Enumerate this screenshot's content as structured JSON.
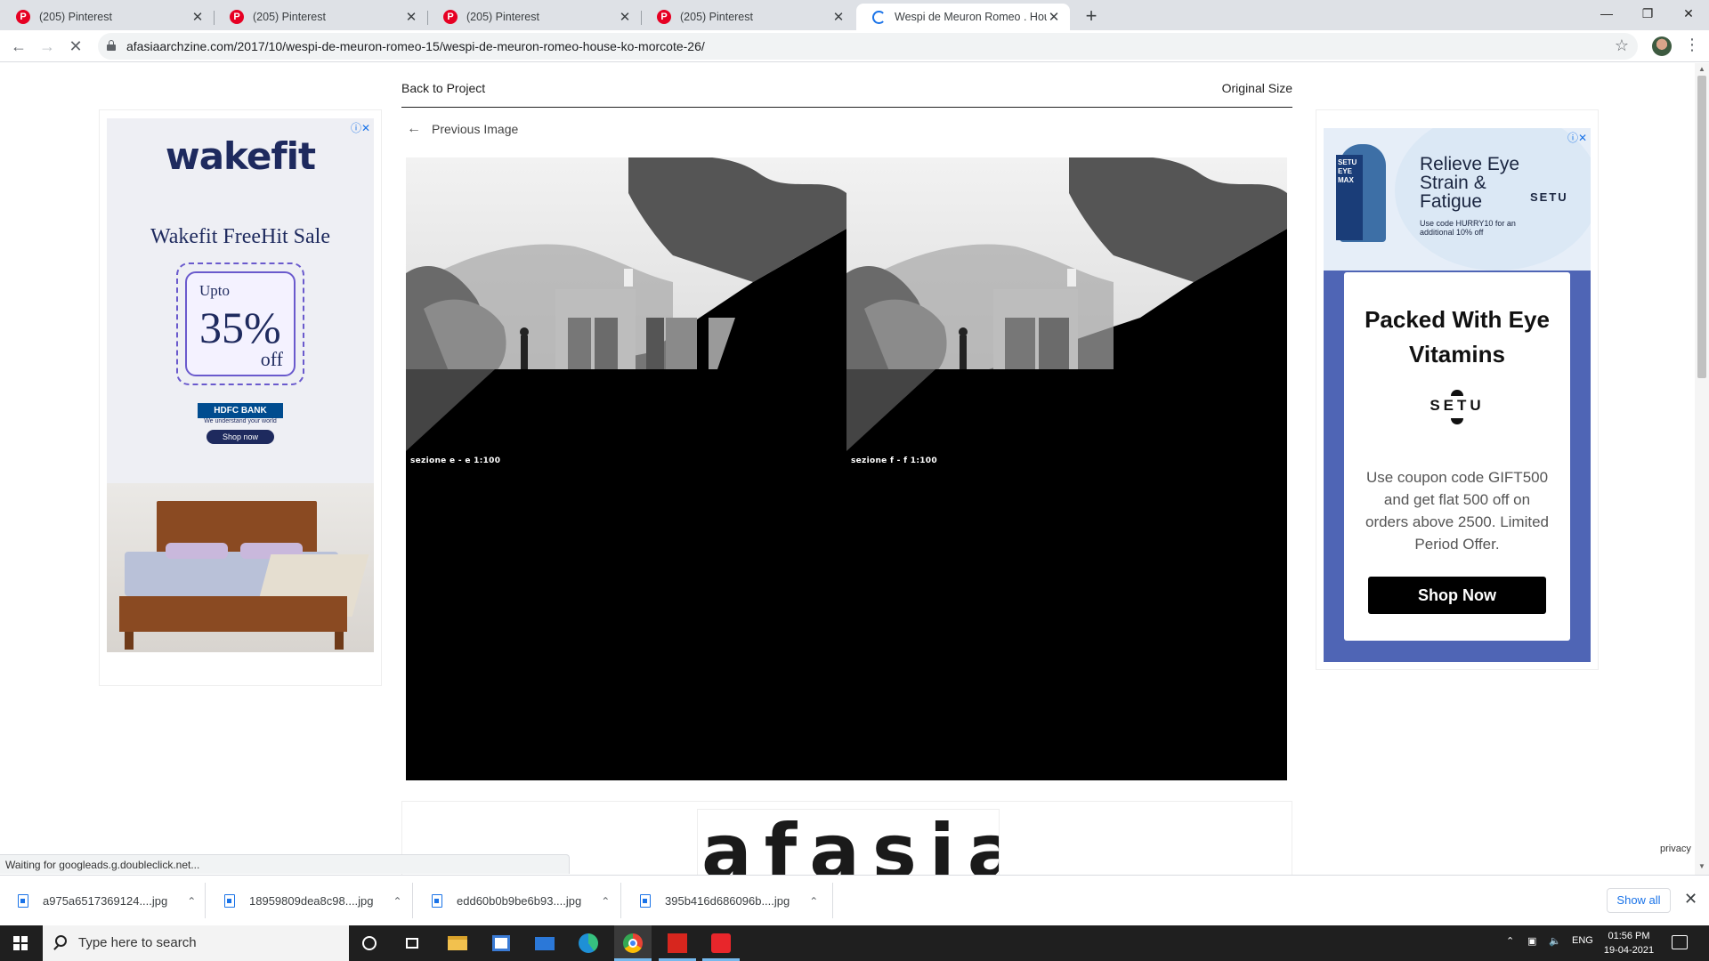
{
  "browser": {
    "tabs": [
      {
        "title": "(205) Pinterest",
        "favicon": "pinterest-icon",
        "active": false
      },
      {
        "title": "(205) Pinterest",
        "favicon": "pinterest-icon",
        "active": false
      },
      {
        "title": "(205) Pinterest",
        "favicon": "pinterest-icon",
        "active": false
      },
      {
        "title": "(205) Pinterest",
        "favicon": "pinterest-icon",
        "active": false
      },
      {
        "title": "Wespi de Meuron Romeo . House",
        "favicon": "loading-spinner-icon",
        "active": true
      }
    ],
    "favicon_letter": "P",
    "close_glyph": "✕",
    "new_tab_glyph": "+",
    "url": "afasiaarchzine.com/2017/10/wespi-de-meuron-romeo-15/wespi-de-meuron-romeo-house-ko-morcote-26/",
    "status": "Waiting for googleads.g.doubleclick.net...",
    "accent_color": "#1a73e8"
  },
  "page": {
    "back_to_project": "Back to Project",
    "original_size": "Original Size",
    "previous_image": "Previous Image",
    "panels": [
      {
        "caption": "sezione  e - e    1:100"
      },
      {
        "caption": "sezione  f - f    1:100"
      }
    ],
    "logo_text": "afasia",
    "privacy": "privacy"
  },
  "ads": {
    "left": {
      "brand": "wakefit",
      "headline": "Wakefit FreeHit Sale",
      "upto": "Upto",
      "percent": "35%",
      "off": "off",
      "bank": "HDFC BANK",
      "bank_tagline": "We understand your world",
      "cta": "Shop now"
    },
    "right": {
      "pack_label": "SETU EYE MAX",
      "headline": "Relieve Eye Strain & Fatigue",
      "code_line": "Use code HURRY10 for an additional 10% off",
      "brand_small": "SETU",
      "card_title": "Packed With Eye Vitamins",
      "card_logo": "SETU",
      "card_body": "Use coupon code GIFT500 and get flat 500 off on orders above 2500. Limited Period Offer.",
      "cta": "Shop Now"
    },
    "adchoices_glyph": "ⓘ✕"
  },
  "downloads": {
    "items": [
      {
        "name": "a975a6517369124....jpg"
      },
      {
        "name": "18959809dea8c98....jpg"
      },
      {
        "name": "edd60b0b9be6b93....jpg"
      },
      {
        "name": "395b416d686096b....jpg"
      }
    ],
    "show_all": "Show all"
  },
  "taskbar": {
    "search_placeholder": "Type here to search",
    "language": "ENG",
    "time": "01:56 PM",
    "date": "19-04-2021"
  }
}
